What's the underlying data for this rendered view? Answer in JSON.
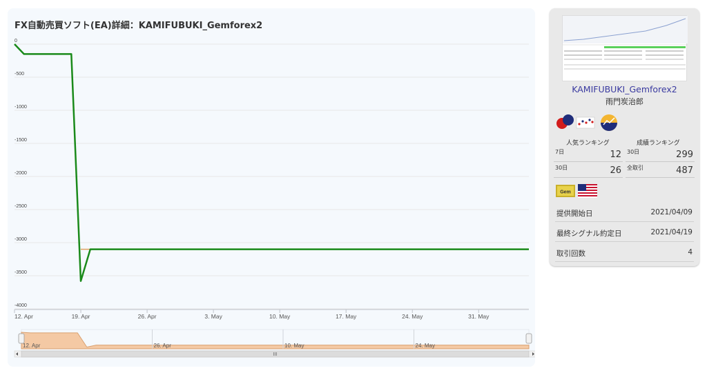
{
  "chart": {
    "title": "FX自動売買ソフト(EA)詳細：KAMIFUBUKI_Gemforex2"
  },
  "chart_data": {
    "type": "line",
    "y_ticks": [
      "0",
      "-500",
      "-1000",
      "-1500",
      "-2000",
      "-2500",
      "-3000",
      "-3500",
      "-4000"
    ],
    "y_tick_values": [
      0,
      -500,
      -1000,
      -1500,
      -2000,
      -2500,
      -3000,
      -3500,
      -4000
    ],
    "ylim": [
      -4000,
      0
    ],
    "x_ticks": [
      "12. Apr",
      "19. Apr",
      "26. Apr",
      "3. May",
      "10. May",
      "17. May",
      "24. May",
      "31. May"
    ],
    "x_tick_days": [
      0,
      7,
      14,
      21,
      28,
      35,
      42,
      49
    ],
    "xlim_days": [
      0,
      54.3
    ],
    "grid": true,
    "series": [
      {
        "color": "#1a8a1a",
        "points": [
          [
            0,
            0
          ],
          [
            1,
            -150
          ],
          [
            6,
            -150
          ],
          [
            7,
            -3580
          ],
          [
            8,
            -3100
          ],
          [
            54.3,
            -3100
          ]
        ]
      },
      {
        "color": "#e0a060",
        "points": [
          [
            7,
            -3100
          ],
          [
            8,
            -3100
          ]
        ]
      }
    ],
    "navigator": {
      "ticks": [
        "12. Apr",
        "26. Apr",
        "10. May",
        "24. May"
      ],
      "tick_days": [
        0,
        14,
        28,
        42
      ],
      "fill_color": "#f4c9a4"
    }
  },
  "card": {
    "name": "KAMIFUBUKI_Gemforex2",
    "author": "雨門炭治郎",
    "popularity_label": "人気ランキング",
    "performance_label": "成績ランキング",
    "rank_7d_label": "7日",
    "rank_7d_value": "12",
    "rank_30d_label": "30日",
    "rank_30d_value": "26",
    "perf_30d_label": "30日",
    "perf_30d_value": "299",
    "perf_all_label": "全取引",
    "perf_all_value": "487",
    "gem_label": "Gem",
    "start_label": "提供開始日",
    "start_value": "2021/04/09",
    "last_signal_label": "最終シグナル約定日",
    "last_signal_value": "2021/04/19",
    "trades_label": "取引回数",
    "trades_value": "4"
  }
}
